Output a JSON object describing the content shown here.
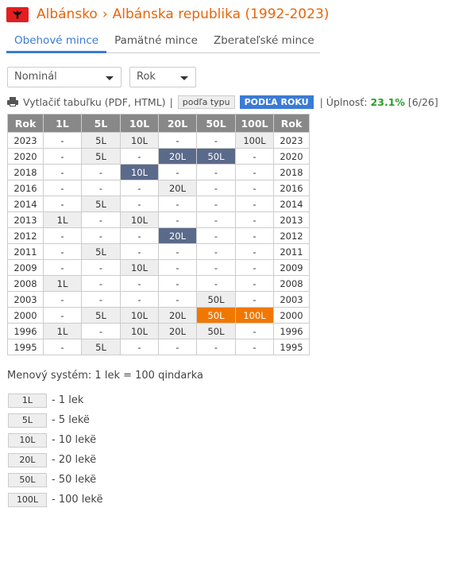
{
  "header": {
    "country": "Albánsko",
    "separator": "›",
    "subtitle": "Albánska republika (1992-2023)"
  },
  "tabs": [
    "Obehové mince",
    "Pamätné mince",
    "Zberateľské mince"
  ],
  "filters": {
    "nominal": "Nominál",
    "year": "Rok"
  },
  "toolbar": {
    "print_label": "Vytlačiť tabuľku (PDF, HTML)",
    "divider": "|",
    "by_type": "podľa typu",
    "by_year": "PODĽA ROKU",
    "completeness_label": "| Úplnosť:",
    "completeness_pct": "23.1%",
    "completeness_count": "[6/26]"
  },
  "table": {
    "headers": [
      "Rok",
      "1L",
      "5L",
      "10L",
      "20L",
      "50L",
      "100L",
      "Rok"
    ],
    "rows": [
      {
        "year": "2023",
        "cells": [
          "-",
          "5L",
          "10L",
          "-",
          "-",
          "100L"
        ]
      },
      {
        "year": "2020",
        "cells": [
          "-",
          "5L",
          "-",
          "20L",
          "50L",
          "-"
        ]
      },
      {
        "year": "2018",
        "cells": [
          "-",
          "-",
          "10L",
          "-",
          "-",
          "-"
        ]
      },
      {
        "year": "2016",
        "cells": [
          "-",
          "-",
          "-",
          "20L",
          "-",
          "-"
        ]
      },
      {
        "year": "2014",
        "cells": [
          "-",
          "5L",
          "-",
          "-",
          "-",
          "-"
        ]
      },
      {
        "year": "2013",
        "cells": [
          "1L",
          "-",
          "10L",
          "-",
          "-",
          "-"
        ]
      },
      {
        "year": "2012",
        "cells": [
          "-",
          "-",
          "-",
          "20L",
          "-",
          "-"
        ]
      },
      {
        "year": "2011",
        "cells": [
          "-",
          "5L",
          "-",
          "-",
          "-",
          "-"
        ]
      },
      {
        "year": "2009",
        "cells": [
          "-",
          "-",
          "10L",
          "-",
          "-",
          "-"
        ]
      },
      {
        "year": "2008",
        "cells": [
          "1L",
          "-",
          "-",
          "-",
          "-",
          "-"
        ]
      },
      {
        "year": "2003",
        "cells": [
          "-",
          "-",
          "-",
          "-",
          "50L",
          "-"
        ]
      },
      {
        "year": "2000",
        "cells": [
          "-",
          "5L",
          "10L",
          "20L",
          "50L",
          "100L"
        ]
      },
      {
        "year": "1996",
        "cells": [
          "1L",
          "-",
          "10L",
          "20L",
          "50L",
          "-"
        ]
      },
      {
        "year": "1995",
        "cells": [
          "-",
          "5L",
          "-",
          "-",
          "-",
          "-"
        ]
      }
    ],
    "highlight_blue": [
      "2020-20L",
      "2020-50L",
      "2018-10L",
      "2012-20L"
    ],
    "highlight_orange": [
      "2000-50L",
      "2000-100L"
    ],
    "colors": {
      "header_bg": "#888888",
      "blue": "#5a6a8a",
      "orange": "#f07800",
      "owned_bg": "#eeeeee"
    }
  },
  "system_text": "Menový systém: 1 lek = 100 qindarka",
  "legend": [
    {
      "chip": "1L",
      "text": "- 1 lek"
    },
    {
      "chip": "5L",
      "text": "- 5 lekë"
    },
    {
      "chip": "10L",
      "text": "- 10 lekë"
    },
    {
      "chip": "20L",
      "text": "- 20 lekë"
    },
    {
      "chip": "50L",
      "text": "- 50 lekë"
    },
    {
      "chip": "100L",
      "text": "- 100 lekë"
    }
  ],
  "icons": {
    "flag": "albania-flag-icon",
    "print": "printer-icon",
    "dropdown": "caret-down-icon"
  }
}
